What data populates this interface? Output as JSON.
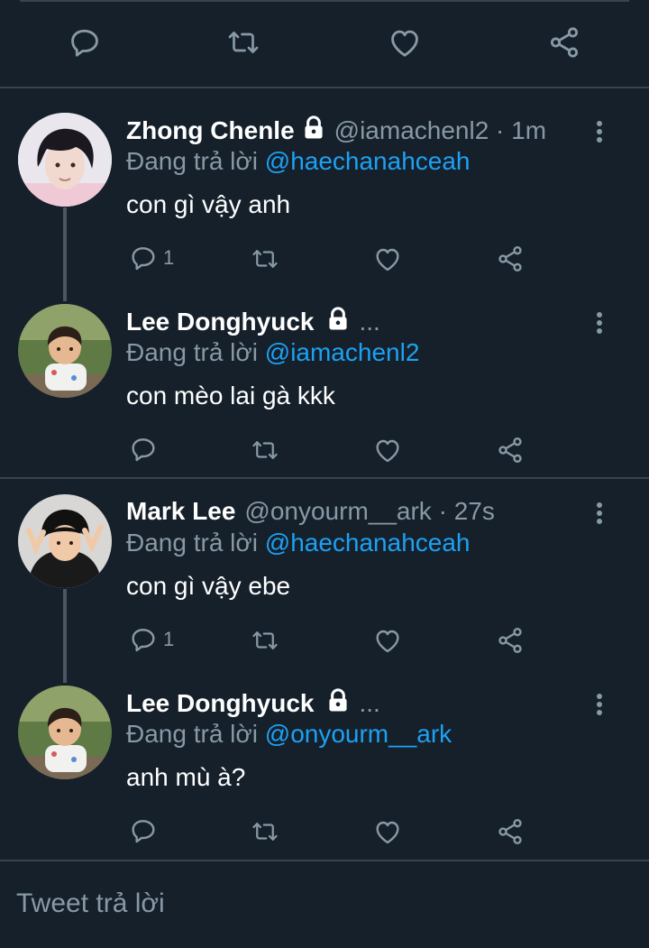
{
  "top_actions": {
    "icons": [
      "reply-icon",
      "retweet-icon",
      "like-icon",
      "share-icon"
    ]
  },
  "tweets": [
    {
      "name": "Zhong Chenle",
      "locked": true,
      "handle": "@iamachenl2 · 1m",
      "reply_prefix": "Đang trả lời ",
      "reply_to": "@haechanahceah",
      "text": "con gì vậy anh",
      "reply_count": "1",
      "avatar_colors": {
        "bg": "#e9e6ee",
        "hair": "#1b1820",
        "skin": "#f1d9cf"
      }
    },
    {
      "name": "Lee Donghyuck",
      "locked": true,
      "handle": "...",
      "reply_prefix": "Đang trả lời ",
      "reply_to": "@iamachenl2",
      "text": "con mèo lai gà kkk",
      "reply_count": "",
      "avatar_colors": {
        "bg": "#5f7a45",
        "hair": "#2b1f17",
        "skin": "#e6b892"
      }
    },
    {
      "name": "Mark Lee",
      "locked": false,
      "handle": "@onyourm__ark · 27s",
      "reply_prefix": "Đang trả lời ",
      "reply_to": "@haechanahceah",
      "text": "con gì vậy ebe",
      "reply_count": "1",
      "avatar_colors": {
        "bg": "#d9d7d5",
        "hair": "#111111",
        "skin": "#f0c9a8"
      }
    },
    {
      "name": "Lee Donghyuck",
      "locked": true,
      "handle": "...",
      "reply_prefix": "Đang trả lời ",
      "reply_to": "@onyourm__ark",
      "text": "anh mù à?",
      "reply_count": "",
      "avatar_colors": {
        "bg": "#5f7a45",
        "hair": "#2b1f17",
        "skin": "#e6b892"
      }
    }
  ],
  "compose": {
    "placeholder": "Tweet trả lời"
  },
  "colors": {
    "background": "#15202b",
    "muted": "#8899a6",
    "link": "#1da1f2",
    "divider": "#38444d"
  }
}
